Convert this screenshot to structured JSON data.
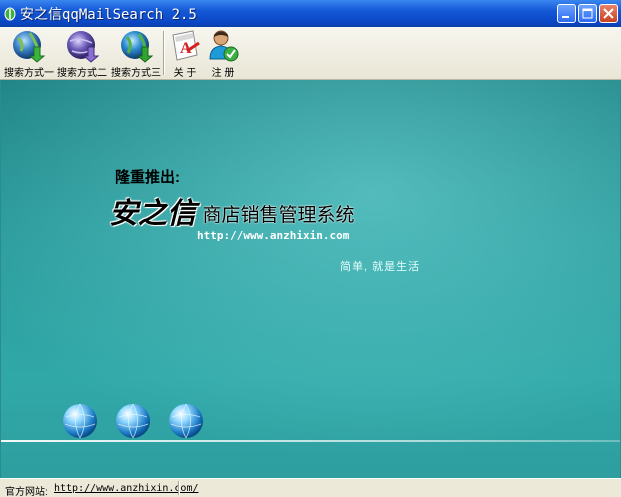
{
  "window": {
    "title": "安之信qqMailSearch 2.5"
  },
  "toolbar": {
    "items": [
      {
        "label": "搜索方式一",
        "icon": "globe-download-icon"
      },
      {
        "label": "搜索方式二",
        "icon": "globe-download-icon"
      },
      {
        "label": "搜索方式三",
        "icon": "globe-download-icon"
      },
      {
        "label": "关 于",
        "icon": "about-book-icon"
      },
      {
        "label": "注 册",
        "icon": "user-register-icon"
      }
    ]
  },
  "banner": {
    "subtitle": "隆重推出:",
    "brand": "安之信",
    "product": "商店销售管理系统",
    "url": "http://www.anzhixin.com",
    "slogan": "简单, 就是生活"
  },
  "statusbar": {
    "label": "官方网站:",
    "link": "http://www.anzhixin.com/"
  },
  "colors": {
    "titlebar": "#0a46c4",
    "canvas": "#2a9a9b",
    "toolbar": "#ece9d8",
    "close_button": "#c6411f"
  }
}
